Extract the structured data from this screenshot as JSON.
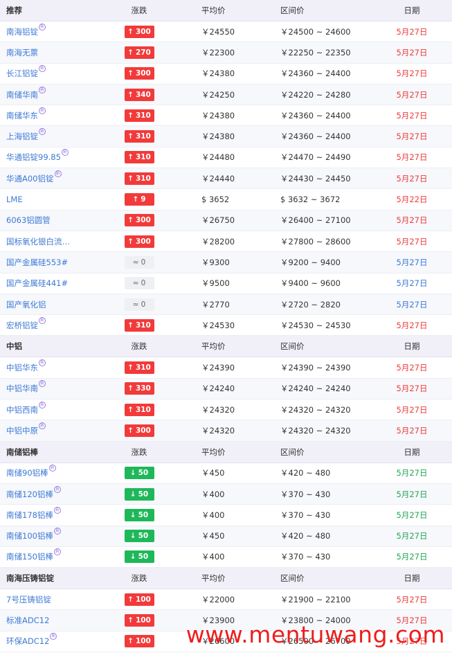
{
  "sections": [
    {
      "header": {
        "name": "推荐",
        "change": "涨跌",
        "avg": "平均价",
        "range": "区间价",
        "date": "日期"
      },
      "rows": [
        {
          "name": "南海铝锭",
          "new": true,
          "dir": "up",
          "change": "300",
          "avg": "￥24550",
          "range": "￥24500 ~ 24600",
          "date": "5月27日"
        },
        {
          "name": "南海无票",
          "new": false,
          "dir": "up",
          "change": "270",
          "avg": "￥22300",
          "range": "￥22250 ~ 22350",
          "date": "5月27日"
        },
        {
          "name": "长江铝锭",
          "new": true,
          "dir": "up",
          "change": "300",
          "avg": "￥24380",
          "range": "￥24360 ~ 24400",
          "date": "5月27日"
        },
        {
          "name": "南储华南",
          "new": true,
          "dir": "up",
          "change": "340",
          "avg": "￥24250",
          "range": "￥24220 ~ 24280",
          "date": "5月27日"
        },
        {
          "name": "南储华东",
          "new": true,
          "dir": "up",
          "change": "310",
          "avg": "￥24380",
          "range": "￥24360 ~ 24400",
          "date": "5月27日"
        },
        {
          "name": "上海铝锭",
          "new": true,
          "dir": "up",
          "change": "310",
          "avg": "￥24380",
          "range": "￥24360 ~ 24400",
          "date": "5月27日"
        },
        {
          "name": "华通铝锭99.85",
          "new": true,
          "dir": "up",
          "change": "310",
          "avg": "￥24480",
          "range": "￥24470 ~ 24490",
          "date": "5月27日"
        },
        {
          "name": "华通A00铝锭",
          "new": true,
          "dir": "up",
          "change": "310",
          "avg": "￥24440",
          "range": "￥24430 ~ 24450",
          "date": "5月27日"
        },
        {
          "name": "LME",
          "new": false,
          "dir": "up",
          "change": "9",
          "avg": "$ 3652",
          "range": "$ 3632 ~ 3672",
          "date": "5月22日"
        },
        {
          "name": "6063铝圆管",
          "new": false,
          "dir": "up",
          "change": "300",
          "avg": "￥26750",
          "range": "￥26400 ~ 27100",
          "date": "5月27日"
        },
        {
          "name": "国标氧化银白流…",
          "new": false,
          "dir": "up",
          "change": "300",
          "avg": "￥28200",
          "range": "￥27800 ~ 28600",
          "date": "5月27日"
        },
        {
          "name": "国产金属硅553#",
          "new": false,
          "dir": "flat",
          "change": "0",
          "avg": "￥9300",
          "range": "￥9200 ~ 9400",
          "date": "5月27日"
        },
        {
          "name": "国产金属硅441#",
          "new": false,
          "dir": "flat",
          "change": "0",
          "avg": "￥9500",
          "range": "￥9400 ~ 9600",
          "date": "5月27日"
        },
        {
          "name": "国产氧化铝",
          "new": false,
          "dir": "flat",
          "change": "0",
          "avg": "￥2770",
          "range": "￥2720 ~ 2820",
          "date": "5月27日"
        },
        {
          "name": "宏桥铝锭",
          "new": true,
          "dir": "up",
          "change": "310",
          "avg": "￥24530",
          "range": "￥24530 ~ 24530",
          "date": "5月27日"
        }
      ]
    },
    {
      "header": {
        "name": "中铝",
        "change": "涨跌",
        "avg": "平均价",
        "range": "区间价",
        "date": "日期"
      },
      "rows": [
        {
          "name": "中铝华东",
          "new": true,
          "dir": "up",
          "change": "310",
          "avg": "￥24390",
          "range": "￥24390 ~ 24390",
          "date": "5月27日"
        },
        {
          "name": "中铝华南",
          "new": true,
          "dir": "up",
          "change": "330",
          "avg": "￥24240",
          "range": "￥24240 ~ 24240",
          "date": "5月27日"
        },
        {
          "name": "中铝西南",
          "new": true,
          "dir": "up",
          "change": "310",
          "avg": "￥24320",
          "range": "￥24320 ~ 24320",
          "date": "5月27日"
        },
        {
          "name": "中铝中原",
          "new": true,
          "dir": "up",
          "change": "300",
          "avg": "￥24320",
          "range": "￥24320 ~ 24320",
          "date": "5月27日"
        }
      ]
    },
    {
      "header": {
        "name": "南储铝棒",
        "change": "涨跌",
        "avg": "平均价",
        "range": "区间价",
        "date": "日期"
      },
      "rows": [
        {
          "name": "南储90铝棒",
          "new": true,
          "dir": "down",
          "change": "50",
          "avg": "￥450",
          "range": "￥420 ~ 480",
          "date": "5月27日"
        },
        {
          "name": "南储120铝棒",
          "new": true,
          "dir": "down",
          "change": "50",
          "avg": "￥400",
          "range": "￥370 ~ 430",
          "date": "5月27日"
        },
        {
          "name": "南储178铝棒",
          "new": true,
          "dir": "down",
          "change": "50",
          "avg": "￥400",
          "range": "￥370 ~ 430",
          "date": "5月27日"
        },
        {
          "name": "南储100铝棒",
          "new": true,
          "dir": "down",
          "change": "50",
          "avg": "￥450",
          "range": "￥420 ~ 480",
          "date": "5月27日"
        },
        {
          "name": "南储150铝棒",
          "new": true,
          "dir": "down",
          "change": "50",
          "avg": "￥400",
          "range": "￥370 ~ 430",
          "date": "5月27日"
        }
      ]
    },
    {
      "header": {
        "name": "南海压铸铝锭",
        "change": "涨跌",
        "avg": "平均价",
        "range": "区间价",
        "date": "日期"
      },
      "rows": [
        {
          "name": "7号压铸铝锭",
          "new": false,
          "dir": "up",
          "change": "100",
          "avg": "￥22000",
          "range": "￥21900 ~ 22100",
          "date": "5月27日"
        },
        {
          "name": "标准ADC12",
          "new": false,
          "dir": "up",
          "change": "100",
          "avg": "￥23900",
          "range": "￥23800 ~ 24000",
          "date": "5月27日"
        },
        {
          "name": "环保ADC12",
          "new": true,
          "dir": "up",
          "change": "100",
          "avg": "￥26600",
          "range": "￥26500 ~ 26700",
          "date": "5月27日"
        }
      ]
    }
  ],
  "symbols": {
    "up": "↑",
    "down": "↓",
    "flat": "≈",
    "new": "新"
  },
  "watermark": "www.mentuwang.com",
  "colors": {
    "up": "#f23a3a",
    "down": "#1eb85a",
    "link": "#3d79d4",
    "header_bg": "#f1f0f8"
  }
}
